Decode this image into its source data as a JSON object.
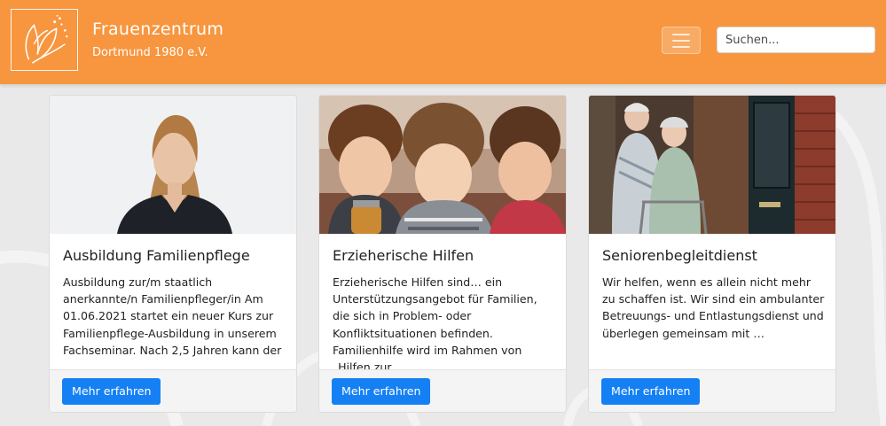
{
  "brand": {
    "title": "Frauenzentrum",
    "subtitle": "Dortmund 1980 e.V.",
    "logo_icon": "tulip-logo-icon"
  },
  "nav": {
    "menu_icon": "hamburger-menu-icon",
    "search_placeholder": "Suchen..."
  },
  "colors": {
    "navbar": "#f7963f",
    "button": "#1580f4",
    "background": "#e9e9ea"
  },
  "cards": [
    {
      "image": "woman-portrait-photo",
      "title": "Ausbildung Familienpflege",
      "text": "Ausbildung zur/m staatlich anerkannte/n Familienpfleger/in Am 01.06.2021 startet ein neuer Kurs zur Familienpflege-Ausbildung in unserem Fachseminar. Nach 2,5 Jahren kann der …",
      "button": "Mehr erfahren"
    },
    {
      "image": "three-children-photo",
      "title": "Erzieherische Hilfen",
      "text": "Erzieherische Hilfen sind… ein Unterstützungsangebot für Familien, die sich in Problem- oder Konfliktsituationen befinden. Familienhilfe wird im Rahmen von „Hilfen zur …",
      "button": "Mehr erfahren"
    },
    {
      "image": "elderly-couple-doorway-photo",
      "title": "Seniorenbegleitdienst",
      "text": "Wir helfen, wenn es allein nicht mehr zu schaffen ist. Wir sind ein ambulanter Betreuungs- und Entlastungsdienst und überlegen gemeinsam mit …",
      "button": "Mehr erfahren"
    }
  ]
}
